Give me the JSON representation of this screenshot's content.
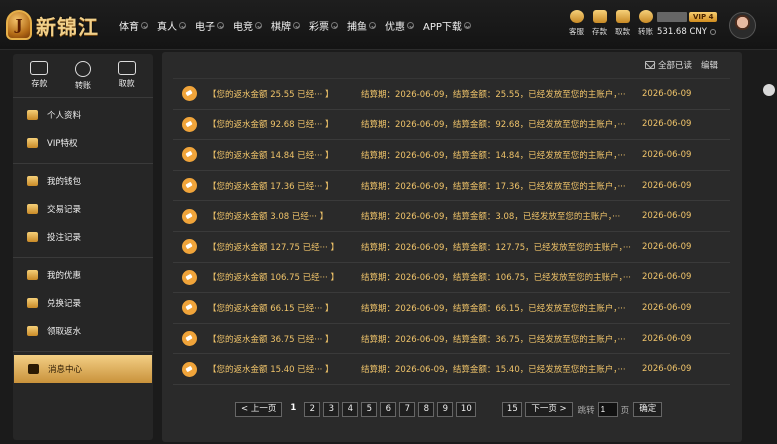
{
  "brand": {
    "logo_letter": "J",
    "name": "新锦江"
  },
  "nav": [
    "体育",
    "真人",
    "电子",
    "电竞",
    "棋牌",
    "彩票",
    "捕鱼",
    "优惠",
    "APP下载"
  ],
  "header_tools": [
    "客服",
    "存款",
    "取款",
    "转账"
  ],
  "account": {
    "vip": "VIP 4",
    "balance": "531.68 CNY"
  },
  "sidebar": {
    "wallet_actions": [
      "存款",
      "转账",
      "取款"
    ],
    "group1": [
      "个人资料",
      "VIP特权"
    ],
    "group2": [
      "我的钱包",
      "交易记录",
      "投注记录"
    ],
    "group3": [
      "我的优惠",
      "兑换记录",
      "领取返水"
    ],
    "group4": [
      "消息中心"
    ]
  },
  "panel": {
    "mark_all_read": "全部已读",
    "edit": "编辑"
  },
  "messages": [
    {
      "title": "【您的返水金额 25.55 已经··· 】",
      "content": "结算期：2026-06-09，结算金额：25.55，已经发放至您的主账户，···",
      "date": "2026-06-09"
    },
    {
      "title": "【您的返水金额 92.68 已经··· 】",
      "content": "结算期：2026-06-09，结算金额：92.68，已经发放至您的主账户，···",
      "date": "2026-06-09"
    },
    {
      "title": "【您的返水金额 14.84 已经··· 】",
      "content": "结算期：2026-06-09，结算金额：14.84，已经发放至您的主账户，···",
      "date": "2026-06-09"
    },
    {
      "title": "【您的返水金额 17.36 已经··· 】",
      "content": "结算期：2026-06-09，结算金额：17.36，已经发放至您的主账户，···",
      "date": "2026-06-09"
    },
    {
      "title": "【您的返水金额 3.08 已经··· 】",
      "content": "结算期：2026-06-09，结算金额：3.08，已经发放至您的主账户，···",
      "date": "2026-06-09"
    },
    {
      "title": "【您的返水金额 127.75 已经··· 】",
      "content": "结算期：2026-06-09，结算金额：127.75，已经发放至您的主账户，···",
      "date": "2026-06-09"
    },
    {
      "title": "【您的返水金额 106.75 已经··· 】",
      "content": "结算期：2026-06-09，结算金额：106.75，已经发放至您的主账户，···",
      "date": "2026-06-09"
    },
    {
      "title": "【您的返水金额 66.15 已经··· 】",
      "content": "结算期：2026-06-09，结算金额：66.15，已经发放至您的主账户，···",
      "date": "2026-06-09"
    },
    {
      "title": "【您的返水金额 36.75 已经··· 】",
      "content": "结算期：2026-06-09，结算金额：36.75，已经发放至您的主账户，···",
      "date": "2026-06-09"
    },
    {
      "title": "【您的返水金额 15.40 已经··· 】",
      "content": "结算期：2026-06-09，结算金额：15.40，已经发放至您的主账户，···",
      "date": "2026-06-09"
    }
  ],
  "pagination": {
    "prev": "< 上一页",
    "current": "1",
    "pages": [
      "2",
      "3",
      "4",
      "5",
      "6",
      "7",
      "8",
      "9",
      "10"
    ],
    "last": "15",
    "next": "下一页 >",
    "goto_label": "跳转",
    "page_unit": "页",
    "page_input_value": "1",
    "confirm": "确定"
  }
}
